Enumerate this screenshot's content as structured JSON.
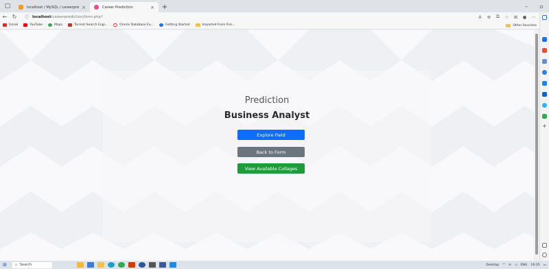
{
  "tabs": [
    {
      "title": "localhost / MySQL / careerpredic",
      "active": false
    },
    {
      "title": "Career Prediction",
      "active": true
    }
  ],
  "address": {
    "host": "localhost",
    "path": "/careerprediction/form.php?"
  },
  "favorites": [
    "Gmail",
    "YouTube",
    "Maps",
    "Torrent Search Engi...",
    "Oracle Database Ex...",
    "Getting Started",
    "Imported From Fire..."
  ],
  "other_favorites": "Other favorites",
  "main": {
    "heading": "Prediction",
    "result": "Business Analyst",
    "buttons": {
      "explore": "Explore Field",
      "back": "Back to Form",
      "colleges": "View Available Collages"
    }
  },
  "taskbar": {
    "search_placeholder": "Search",
    "desktop": "Desktop",
    "lang": "ENG",
    "time": "16:35"
  },
  "colors": {
    "primary": "#0d6efd",
    "secondary": "#6c757d",
    "success": "#1e9b3a"
  }
}
